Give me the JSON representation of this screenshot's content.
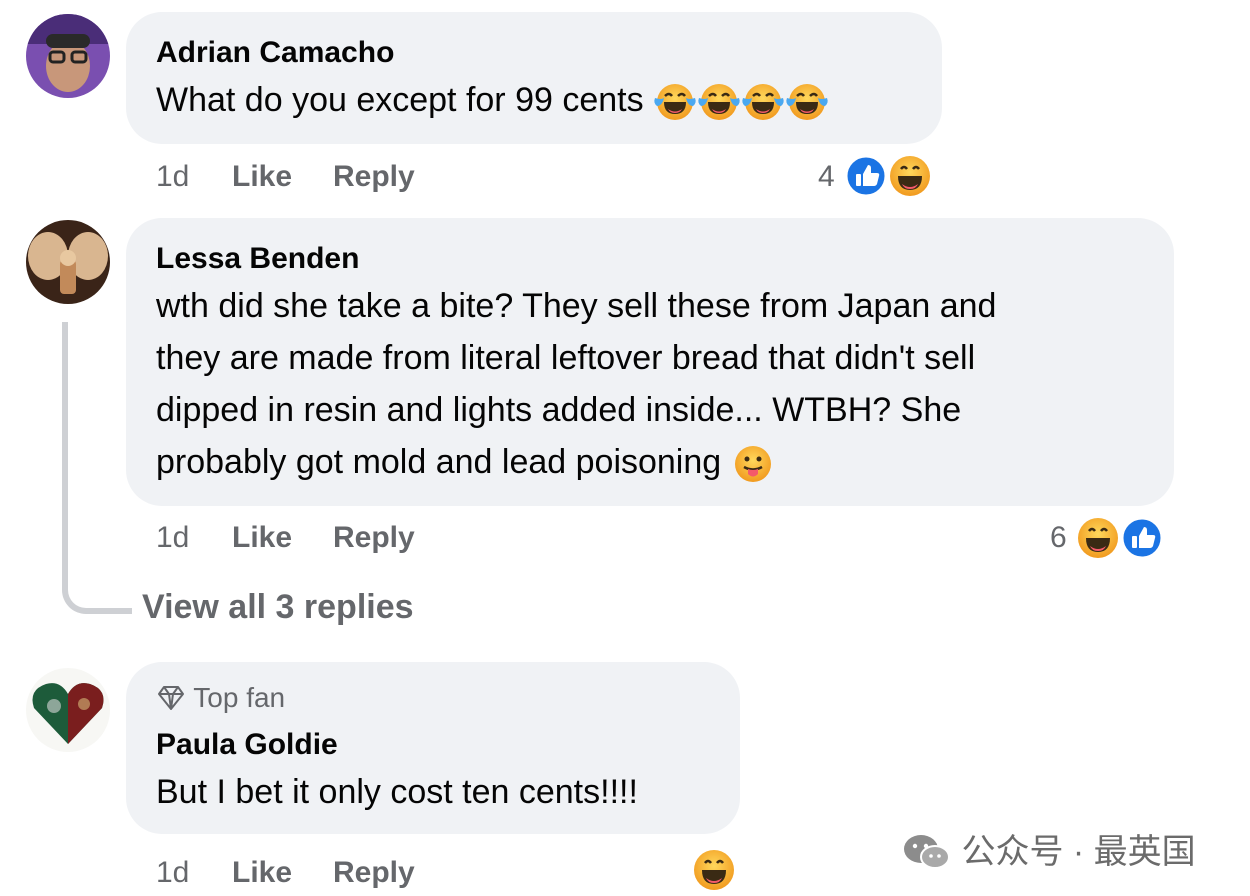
{
  "comments": [
    {
      "author": "Adrian Camacho",
      "text": "What do you except for 99 cents",
      "text_emojis": [
        "laughing-tears-emoji",
        "laughing-tears-emoji",
        "laughing-tears-emoji",
        "laughing-tears-emoji"
      ],
      "time": "1d",
      "like_label": "Like",
      "reply_label": "Reply",
      "reaction_count": "4",
      "reactions": [
        "like-icon",
        "laugh-emoji"
      ]
    },
    {
      "author": "Lessa Benden",
      "text_lines": [
        "wth did she take a bite? They sell these from Japan and",
        "they are made from literal leftover bread that didn't sell",
        "dipped in resin and lights added inside... WTBH? She",
        "probably got mold and lead poisoning"
      ],
      "text_emojis": [
        "tongue-out-emoji"
      ],
      "time": "1d",
      "like_label": "Like",
      "reply_label": "Reply",
      "reaction_count": "6",
      "reactions": [
        "laugh-emoji",
        "like-icon"
      ],
      "view_replies_label": "View all 3 replies"
    },
    {
      "badge": "Top fan",
      "author": "Paula Goldie",
      "text": "But I bet it only cost ten cents!!!!",
      "time": "1d",
      "like_label": "Like",
      "reply_label": "Reply",
      "reactions": [
        "laugh-emoji"
      ]
    }
  ],
  "watermark": {
    "text": "公众号 · 最英国",
    "icon": "wechat-icon"
  },
  "colors": {
    "bubble": "#f0f2f5",
    "meta": "#65676b",
    "like_blue": "#1b74e4",
    "emoji_yellow": "#f7b125"
  }
}
